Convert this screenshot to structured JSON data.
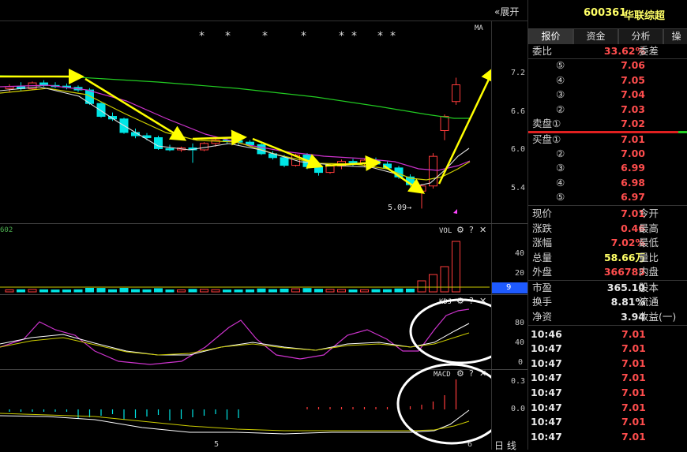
{
  "toolbar": {
    "expand_label": "展开"
  },
  "chart": {
    "price_panel": {
      "indicator_label": "MA",
      "stars": [
        "*",
        "*",
        "*",
        "*",
        "*",
        "*",
        "*",
        "*"
      ],
      "y_ticks": [
        "7.2",
        "6.6",
        "6.0",
        "5.4"
      ],
      "low_annotation": "5.09"
    },
    "vol_panel": {
      "title": "VOL",
      "y_ticks": [
        "40",
        "20"
      ],
      "current_marker": "9",
      "left_cut_text": "602"
    },
    "kdj_panel": {
      "title": "KDJ",
      "y_ticks": [
        "80",
        "40",
        "0"
      ]
    },
    "macd_panel": {
      "title": "MACD",
      "y_ticks": [
        "0.3",
        "0.0"
      ]
    },
    "x_ticks": [
      "5",
      "6"
    ],
    "corner_label": "日 线",
    "panel_controls": {
      "settings": "⚙",
      "help": "?",
      "close": "✕"
    }
  },
  "chart_data": {
    "type": "candlestick",
    "symbol": "600361",
    "y_ticks": [
      7.2,
      6.6,
      6.0,
      5.4
    ],
    "annotated_low": 5.09,
    "ohlc": [
      [
        6.95,
        7.02,
        6.9,
        6.98
      ],
      [
        6.98,
        7.05,
        6.92,
        6.95
      ],
      [
        6.95,
        7.06,
        6.93,
        7.04
      ],
      [
        7.04,
        7.08,
        6.98,
        7.0
      ],
      [
        7.0,
        7.05,
        6.96,
        6.99
      ],
      [
        6.99,
        7.03,
        6.94,
        6.97
      ],
      [
        6.97,
        7.0,
        6.9,
        6.93
      ],
      [
        6.93,
        6.96,
        6.7,
        6.72
      ],
      [
        6.72,
        6.75,
        6.5,
        6.52
      ],
      [
        6.52,
        6.58,
        6.45,
        6.48
      ],
      [
        6.48,
        6.5,
        6.25,
        6.27
      ],
      [
        6.27,
        6.33,
        6.18,
        6.22
      ],
      [
        6.22,
        6.26,
        6.15,
        6.19
      ],
      [
        6.19,
        6.22,
        6.0,
        6.02
      ],
      [
        6.02,
        6.08,
        5.98,
        6.0
      ],
      [
        6.0,
        6.05,
        5.97,
        6.03
      ],
      [
        6.03,
        6.1,
        5.8,
        6.0
      ],
      [
        6.0,
        6.12,
        5.98,
        6.1
      ],
      [
        6.1,
        6.18,
        6.05,
        6.15
      ],
      [
        6.15,
        6.2,
        6.1,
        6.14
      ],
      [
        6.14,
        6.18,
        6.08,
        6.12
      ],
      [
        6.12,
        6.15,
        6.05,
        6.08
      ],
      [
        6.08,
        6.12,
        5.92,
        5.94
      ],
      [
        5.94,
        5.98,
        5.85,
        5.88
      ],
      [
        5.88,
        5.92,
        5.73,
        5.76
      ],
      [
        5.76,
        5.94,
        5.74,
        5.92
      ],
      [
        5.92,
        5.95,
        5.7,
        5.74
      ],
      [
        5.74,
        5.78,
        5.6,
        5.65
      ],
      [
        5.65,
        5.78,
        5.63,
        5.75
      ],
      [
        5.75,
        5.85,
        5.7,
        5.82
      ],
      [
        5.82,
        5.86,
        5.75,
        5.8
      ],
      [
        5.8,
        5.86,
        5.74,
        5.84
      ],
      [
        5.84,
        5.88,
        5.76,
        5.78
      ],
      [
        5.78,
        5.82,
        5.7,
        5.72
      ],
      [
        5.72,
        5.75,
        5.55,
        5.58
      ],
      [
        5.58,
        5.62,
        5.43,
        5.46
      ],
      [
        5.36,
        5.47,
        5.09,
        5.44
      ],
      [
        5.44,
        5.95,
        5.4,
        5.9
      ],
      [
        6.3,
        6.55,
        6.15,
        6.52
      ],
      [
        6.75,
        7.12,
        6.7,
        7.01
      ]
    ]
  },
  "quote": {
    "code": "600361",
    "name": "华联综超",
    "tabs": [
      "报价",
      "资金",
      "分析",
      "操"
    ],
    "webi_label": "委比",
    "webi_value": "33.62%",
    "weicha_label": "委差",
    "sell_levels": [
      {
        "label": "⑤",
        "price": "7.06"
      },
      {
        "label": "④",
        "price": "7.05"
      },
      {
        "label": "③",
        "price": "7.04"
      },
      {
        "label": "②",
        "price": "7.03"
      },
      {
        "label": "卖盘①",
        "price": "7.02"
      }
    ],
    "buy_levels": [
      {
        "label": "买盘①",
        "price": "7.01"
      },
      {
        "label": "②",
        "price": "7.00"
      },
      {
        "label": "③",
        "price": "6.99"
      },
      {
        "label": "④",
        "price": "6.98"
      },
      {
        "label": "⑤",
        "price": "6.97"
      }
    ],
    "stats": [
      {
        "l1": "现价",
        "v": "7.01",
        "l2": "今开",
        "color": "red"
      },
      {
        "l1": "涨跌",
        "v": "0.46",
        "l2": "最高",
        "color": "red"
      },
      {
        "l1": "涨幅",
        "v": "7.02%",
        "l2": "最低",
        "color": "red"
      },
      {
        "l1": "总量",
        "v": "58.66万",
        "l2": "量比",
        "color": "yellow"
      },
      {
        "l1": "外盘",
        "v": "366783",
        "l2": "内盘",
        "color": "red"
      }
    ],
    "fundamentals": [
      {
        "l1": "市盈",
        "v": "365.10",
        "l2": "股本"
      },
      {
        "l1": "换手",
        "v": "8.81%",
        "l2": "流通"
      },
      {
        "l1": "净资",
        "v": "3.94",
        "l2": "收益(一)"
      }
    ],
    "ticks": [
      {
        "time": "10:46",
        "price": "7.01"
      },
      {
        "time": "10:47",
        "price": "7.01"
      },
      {
        "time": "10:47",
        "price": "7.01"
      },
      {
        "time": "10:47",
        "price": "7.01"
      },
      {
        "time": "10:47",
        "price": "7.01"
      },
      {
        "time": "10:47",
        "price": "7.01"
      },
      {
        "time": "10:47",
        "price": "7.01"
      },
      {
        "time": "10:47",
        "price": "7.01"
      }
    ]
  }
}
